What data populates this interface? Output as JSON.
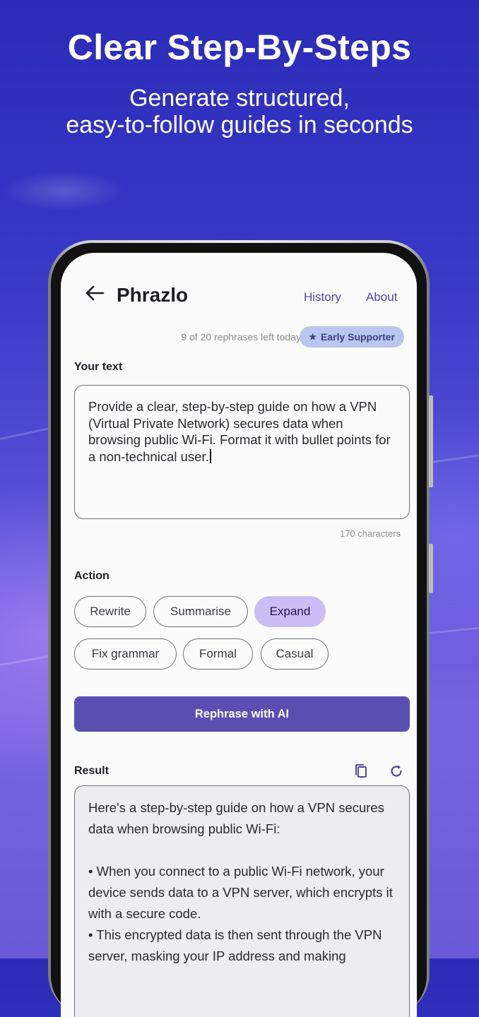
{
  "promo": {
    "headline": "Clear Step-By-Steps",
    "subline_1": "Generate structured,",
    "subline_2": "easy-to-follow guides in seconds"
  },
  "app": {
    "title": "Phrazlo",
    "nav": {
      "history": "History",
      "about": "About"
    },
    "quota": "9 of 20 rephrases left today",
    "badge": "Early Supporter",
    "input": {
      "label": "Your text",
      "value": "Provide a clear, step-by-step guide on how a VPN (Virtual Private Network) secures data when browsing public Wi-Fi. Format it with bullet points for a non-technical user.",
      "char_count": "170 characters"
    },
    "action": {
      "label": "Action",
      "chips": [
        "Rewrite",
        "Summarise",
        "Expand",
        "Fix grammar",
        "Formal",
        "Casual"
      ],
      "selected": "Expand"
    },
    "cta": "Rephrase with AI",
    "result": {
      "label": "Result",
      "text": "Here's a step-by-step guide on how a VPN secures data when browsing public Wi-Fi:\n\n• When you connect to a public Wi-Fi network, your device sends data to a VPN server, which encrypts it with a secure code.\n• This encrypted data is then sent through the VPN server, masking your IP address and making"
    }
  },
  "colors": {
    "accent": "#5a4fb0",
    "chip_selected": "#cbbdf6",
    "badge_bg": "#b9c6ef",
    "link": "#4d45a8"
  },
  "icons": [
    "back-arrow-icon",
    "star-icon",
    "copy-icon",
    "refresh-icon"
  ]
}
